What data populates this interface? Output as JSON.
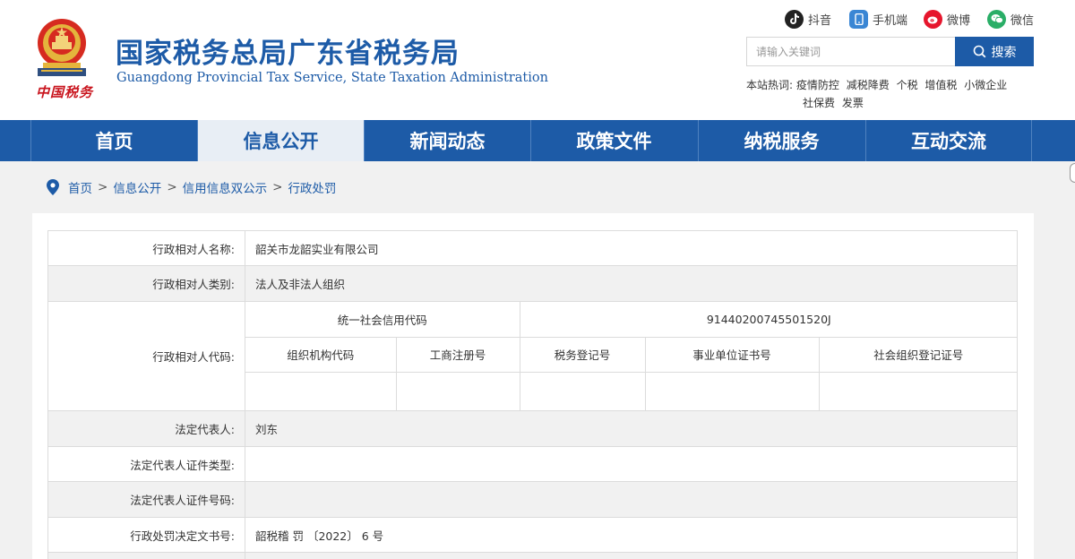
{
  "header": {
    "title": "国家税务总局广东省税务局",
    "subtitle": "Guangdong Provincial Tax Service, State Taxation Administration",
    "seal_text": "中国税务",
    "social": [
      {
        "label": "抖音",
        "icon": "douyin-icon",
        "color": "#222222"
      },
      {
        "label": "手机端",
        "icon": "mobile-icon",
        "color": "#3a86d4"
      },
      {
        "label": "微博",
        "icon": "weibo-icon",
        "color": "#e6162d"
      },
      {
        "label": "微信",
        "icon": "wechat-icon",
        "color": "#2aae67"
      }
    ],
    "search": {
      "placeholder": "请输入关键词",
      "button": "搜索"
    },
    "hot": {
      "label": "本站热词:",
      "words": [
        "疫情防控",
        "减税降费",
        "个税",
        "增值税",
        "小微企业",
        "社保费",
        "发票"
      ]
    }
  },
  "nav": {
    "items": [
      "首页",
      "信息公开",
      "新闻动态",
      "政策文件",
      "纳税服务",
      "互动交流"
    ],
    "active": "信息公开"
  },
  "breadcrumb": [
    "首页",
    "信息公开",
    "信用信息双公示",
    "行政处罚"
  ],
  "detail": {
    "name_label": "行政相对人名称:",
    "name_value": "韶关市龙韶实业有限公司",
    "category_label": "行政相对人类别:",
    "category_value": "法人及非法人组织",
    "code_label": "行政相对人代码:",
    "credit_code_label": "统一社会信用代码",
    "credit_code_value": "91440200745501520J",
    "code_columns": [
      "组织机构代码",
      "工商注册号",
      "税务登记号",
      "事业单位证书号",
      "社会组织登记证号"
    ],
    "legal_rep_label": "法定代表人:",
    "legal_rep_value": "刘东",
    "id_type_label": "法定代表人证件类型:",
    "id_type_value": "",
    "id_number_label": "法定代表人证件号码:",
    "id_number_value": "",
    "decision_no_label": "行政处罚决定文书号:",
    "decision_no_value": "韶税稽 罚 〔2022〕 6 号"
  },
  "colors": {
    "brand_blue": "#1d5ba7",
    "nav_active_bg": "#e8eef5",
    "seal_red": "#c9151e",
    "page_bg": "#f1f1f1"
  }
}
